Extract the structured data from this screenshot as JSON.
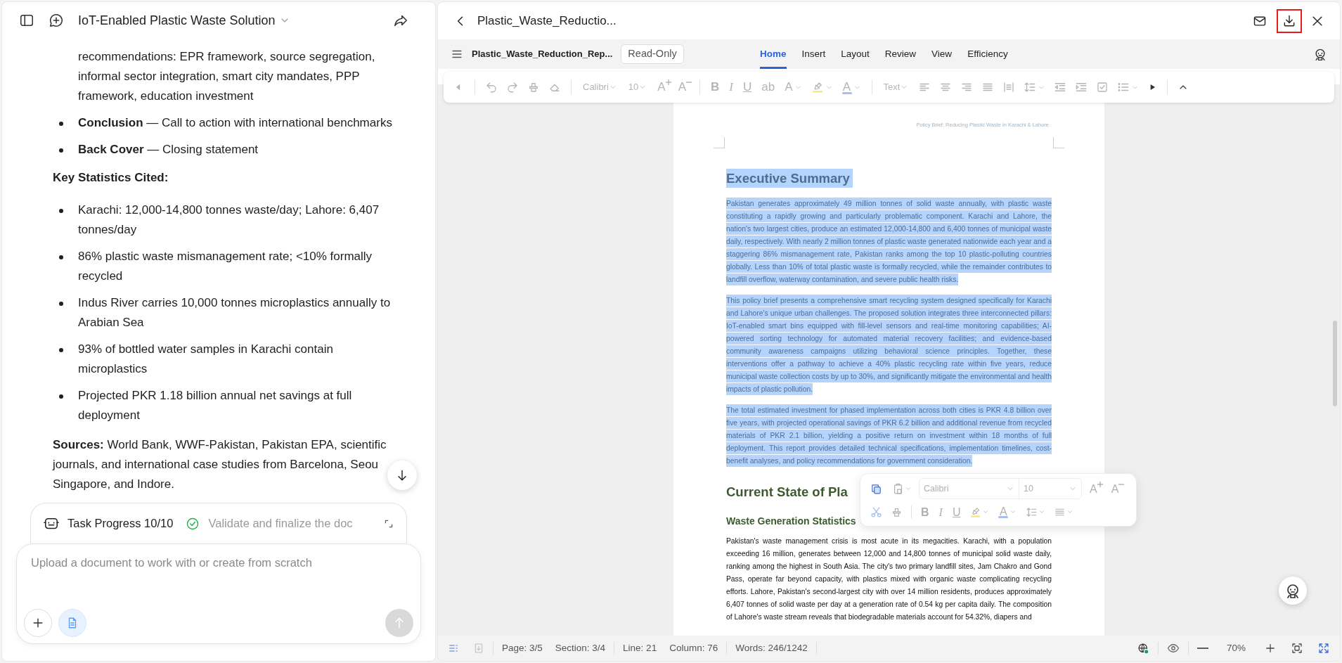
{
  "chat": {
    "title": "IoT-Enabled Plastic Waste Solution",
    "blocks": [
      {
        "kind": "continuation",
        "text": "recommendations: EPR framework, source segregation, informal sector integration, smart city mandates, PPP framework, education investment"
      },
      {
        "kind": "bullet",
        "text": "**Conclusion** — Call to action with international benchmarks"
      },
      {
        "kind": "bullet",
        "text": "**Back Cover** — Closing statement"
      },
      {
        "kind": "heading",
        "text": "Key Statistics Cited:"
      },
      {
        "kind": "bullet",
        "text": "Karachi: 12,000-14,800 tonnes waste/day; Lahore: 6,407 tonnes/day"
      },
      {
        "kind": "bullet",
        "text": "86% plastic waste mismanagement rate; <10% formally recycled"
      },
      {
        "kind": "bullet",
        "text": "Indus River carries 10,000 tonnes microplastics annually to Arabian Sea"
      },
      {
        "kind": "bullet",
        "text": "93% of bottled water samples in Karachi contain microplastics"
      },
      {
        "kind": "bullet",
        "text": "Projected PKR 1.18 billion annual net savings at full deployment"
      },
      {
        "kind": "paragraph",
        "text": "**Sources:** World Bank, WWF-Pakistan, Pakistan EPA, scientific journals, and international case studies from Barcelona, Seou"
      },
      {
        "kind": "line",
        "text": "Singapore, and Indore."
      }
    ],
    "task_progress": {
      "label": "Task Progress 10/10",
      "done": true,
      "step": "Validate and finalize the doc"
    },
    "composer": {
      "placeholder": "Upload a document to work with or create from scratch",
      "document_mode": true
    }
  },
  "document": {
    "title": "Plastic_Waste_Reductio...",
    "download_highlighted": true,
    "file_name": "Plastic_Waste_Reduction_Rep...",
    "mode_badge": "Read-Only",
    "tabs": [
      {
        "label": "Home",
        "selected": true
      },
      {
        "label": "Insert",
        "selected": false
      },
      {
        "label": "Layout",
        "selected": false
      },
      {
        "label": "Review",
        "selected": false
      },
      {
        "label": "View",
        "selected": false
      },
      {
        "label": "Efficiency",
        "selected": false
      }
    ],
    "toolbar": {
      "disabled": true,
      "font": "Calibri",
      "size": "10",
      "style": "Text",
      "grow": "A",
      "shrink": "A",
      "bold": "B",
      "italic": "I",
      "underline": "U",
      "strike": "ab",
      "effects": "A",
      "font_color_label": "A"
    },
    "page": {
      "header": "Policy Brief: Reducing Plastic Waste in Karachi & Lahore",
      "blocks": [
        {
          "kind": "h1",
          "selected": true,
          "text": "Executive Summary"
        },
        {
          "kind": "p",
          "selected": true,
          "text": "Pakistan generates approximately 49 million tonnes of solid waste annually, with plastic waste constituting a rapidly growing and particularly problematic component. Karachi and Lahore, the nation's two largest cities, produce an estimated 12,000-14,800 and 6,400 tonnes of municipal waste daily, respectively. With nearly 2 million tonnes of plastic waste generated nationwide each year and a staggering 86% mismanagement rate, Pakistan ranks among the top 10 plastic-polluting countries globally. Less than 10% of total plastic waste is formally recycled, while the remainder contributes to landfill overflow, waterway contamination, and severe public health risks."
        },
        {
          "kind": "p",
          "selected": true,
          "text": "This policy brief presents a comprehensive smart recycling system designed specifically for Karachi and Lahore's unique urban challenges. The proposed solution integrates three interconnected pillars: IoT-enabled smart bins equipped with fill-level sensors and real-time monitoring capabilities; AI-powered sorting technology for automated material recovery facilities; and evidence-based community awareness campaigns utilizing behavioral science principles. Together, these interventions offer a pathway to achieve a 40% plastic recycling rate within five years, reduce municipal waste collection costs by up to 30%, and significantly mitigate the environmental and health impacts of plastic pollution."
        },
        {
          "kind": "p",
          "selected": true,
          "text": "The total estimated investment for phased implementation across both cities is PKR 4.8 billion over five years, with projected operational savings of PKR 6.2 billion and additional revenue from recycled materials of PKR 2.1 billion, yielding a positive return on investment within 18 months of full deployment. This report provides detailed technical specifications, implementation timelines, cost-benefit analyses, and policy recommendations for government consideration."
        },
        {
          "kind": "h1",
          "selected": false,
          "text": "Current State of Pla"
        },
        {
          "kind": "h2",
          "selected": false,
          "text": "Waste Generation Statistics"
        },
        {
          "kind": "p",
          "selected": false,
          "text": "Pakistan's waste management crisis is most acute in its megacities. Karachi, with a population exceeding 16 million, generates between 12,000 and 14,800 tonnes of municipal solid waste daily, ranking among the highest in South Asia. The city's two primary landfill sites, Jam Chakro and Gond Pass, operate far beyond capacity, with plastics mixed with organic waste complicating recycling efforts. Lahore, Pakistan's second-largest city with over 14 million residents, produces approximately 6,407 tonnes of solid waste per day at a generation rate of 0.54 kg per capita daily. The composition of Lahore's waste stream reveals that biodegradable materials account for 54.32%, diapers and"
        }
      ]
    },
    "floating_toolbar": {
      "font": "Calibri",
      "size": "10",
      "grow": "A",
      "shrink": "A",
      "bold": "B",
      "italic": "I",
      "underline": "U",
      "font_color_label": "A"
    },
    "status_bar": {
      "page": "Page: 3/5",
      "section": "Section: 3/4",
      "line": "Line: 21",
      "column": "Column: 76",
      "words": "Words: 246/1242",
      "zoom": "70%"
    }
  }
}
